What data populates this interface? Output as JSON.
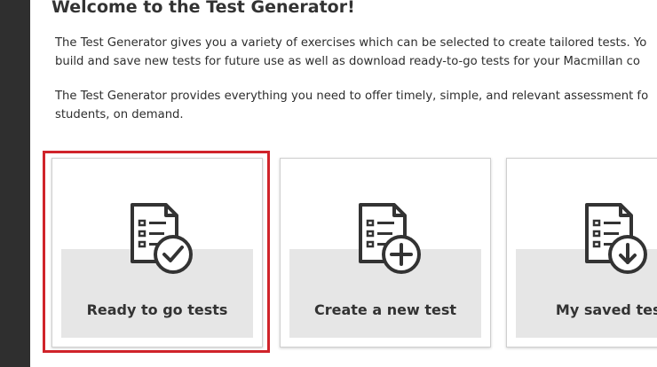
{
  "page": {
    "title": "Welcome to the Test Generator!",
    "intro": {
      "line1": "The Test Generator gives you a variety of exercises which can be selected to create tailored tests. Yo",
      "line2": "build and save new tests for future use as well as download ready-to-go tests for your Macmillan co"
    },
    "description": {
      "line1": "The Test Generator provides everything you need to offer timely, simple, and relevant assessment fo",
      "line2": "students, on demand."
    }
  },
  "cards": [
    {
      "label": "Ready to go tests",
      "icon": "document-check-icon"
    },
    {
      "label": "Create a new test",
      "icon": "document-plus-icon"
    },
    {
      "label": "My saved test",
      "icon": "document-download-icon"
    }
  ],
  "colors": {
    "highlight": "#d0232a",
    "card_background": "#e6e6e6",
    "sidebar": "#2f2f2f"
  }
}
